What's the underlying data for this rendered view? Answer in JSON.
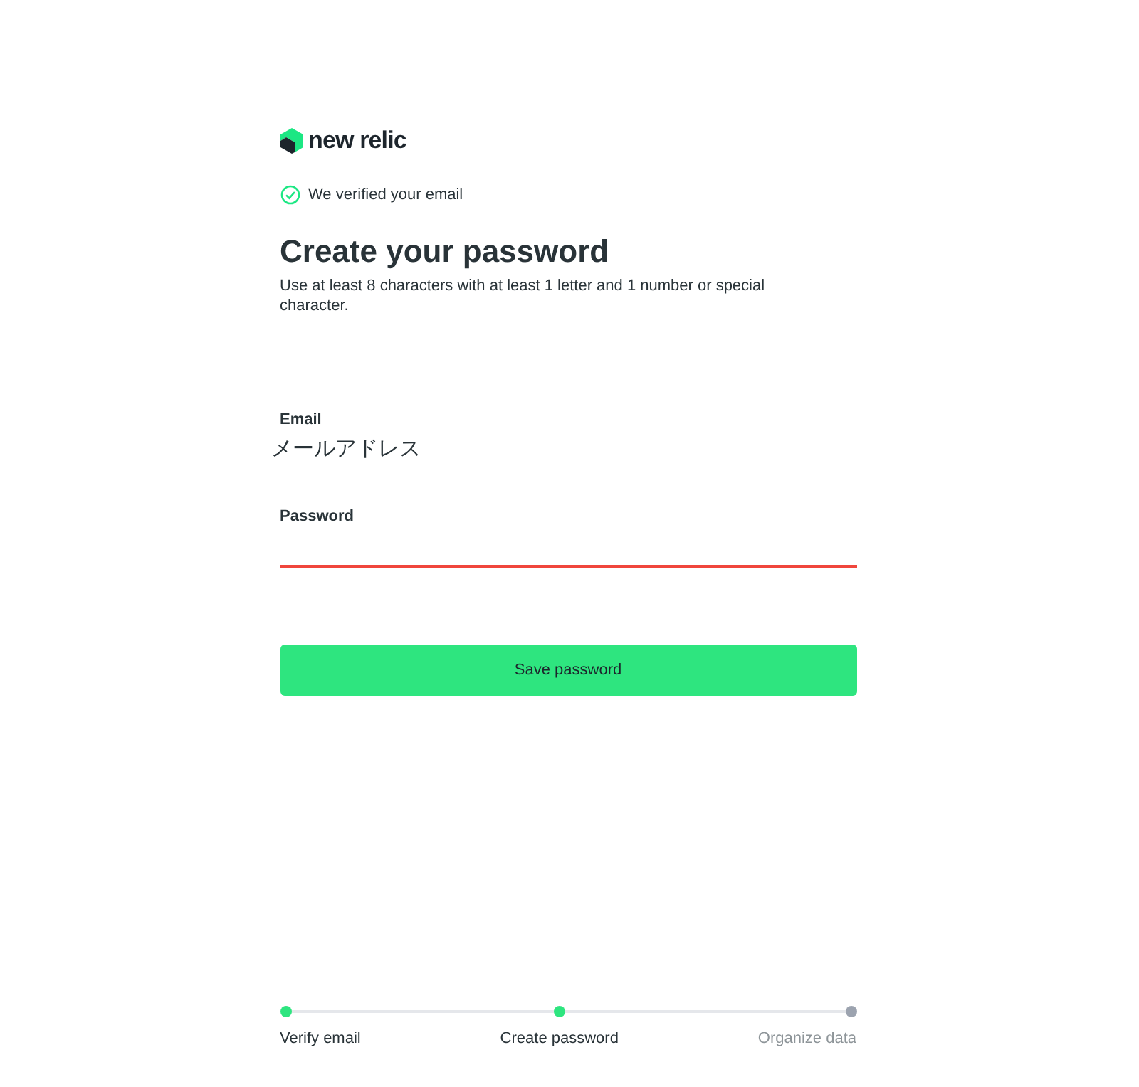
{
  "logo": {
    "text": "new relic"
  },
  "verified": {
    "text": "We verified your email",
    "checked": true
  },
  "title": "Create your password",
  "subtitle": "Use at least 8 characters with at least 1 letter and 1 number or special character.",
  "email": {
    "label": "Email",
    "value": "メールアドレス"
  },
  "password": {
    "label": "Password",
    "invalid": true
  },
  "button": "Save password",
  "steps": [
    {
      "label": "Verify email",
      "done": true
    },
    {
      "label": "Create password",
      "done": true
    },
    {
      "label": "Organize data",
      "done": false
    }
  ]
}
